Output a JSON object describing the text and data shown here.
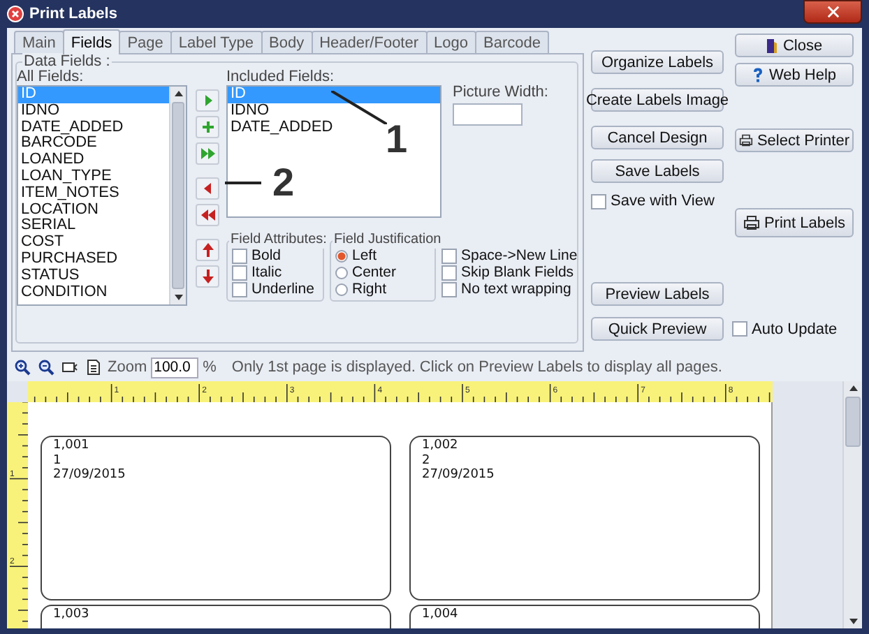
{
  "window": {
    "title": "Print Labels"
  },
  "tabs": [
    {
      "label": "Main",
      "selected": false
    },
    {
      "label": "Fields",
      "selected": true
    },
    {
      "label": "Page",
      "selected": false
    },
    {
      "label": "Label Type",
      "selected": false
    },
    {
      "label": "Body",
      "selected": false
    },
    {
      "label": "Header/Footer",
      "selected": false
    },
    {
      "label": "Logo",
      "selected": false
    },
    {
      "label": "Barcode",
      "selected": false
    }
  ],
  "data_fields": {
    "title": "Data Fields :",
    "all_fields_label": "All Fields:",
    "all_fields": [
      {
        "label": "ID",
        "selected": true
      },
      {
        "label": "IDNO",
        "selected": false
      },
      {
        "label": "DATE_ADDED",
        "selected": false
      },
      {
        "label": "BARCODE",
        "selected": false
      },
      {
        "label": "LOANED",
        "selected": false
      },
      {
        "label": "LOAN_TYPE",
        "selected": false
      },
      {
        "label": "ITEM_NOTES",
        "selected": false
      },
      {
        "label": "LOCATION",
        "selected": false
      },
      {
        "label": "SERIAL",
        "selected": false
      },
      {
        "label": "COST",
        "selected": false
      },
      {
        "label": "PURCHASED",
        "selected": false
      },
      {
        "label": "STATUS",
        "selected": false
      },
      {
        "label": "CONDITION",
        "selected": false
      }
    ],
    "included_fields_label": "Included Fields:",
    "included_fields": [
      {
        "label": "ID",
        "selected": true
      },
      {
        "label": "IDNO",
        "selected": false
      },
      {
        "label": "DATE_ADDED",
        "selected": false
      }
    ],
    "picture_width_label": "Picture Width:",
    "field_attributes": {
      "title": "Field Attributes:",
      "options": [
        {
          "label": "Bold",
          "checked": false
        },
        {
          "label": "Italic",
          "checked": false
        },
        {
          "label": "Underline",
          "checked": false
        }
      ]
    },
    "field_justification": {
      "title": "Field Justification",
      "options": [
        {
          "label": "Left",
          "selected": true
        },
        {
          "label": "Center",
          "selected": false
        },
        {
          "label": "Right",
          "selected": false
        }
      ]
    },
    "options": [
      {
        "label": "Space->New Line",
        "checked": false
      },
      {
        "label": "Skip Blank Fields",
        "checked": false
      },
      {
        "label": "No text wrapping",
        "checked": false
      }
    ]
  },
  "annotations": [
    {
      "text": "1"
    },
    {
      "text": "2"
    }
  ],
  "design_buttons": [
    "Organize Labels",
    "Create Labels Image",
    "Cancel Design",
    "Save Labels"
  ],
  "save_with_view": {
    "label": "Save with View",
    "checked": false
  },
  "preview_buttons": [
    "Preview Labels",
    "Quick Preview"
  ],
  "auto_update": {
    "label": "Auto Update",
    "checked": false
  },
  "side_buttons": [
    {
      "label": "Close",
      "kind": "close"
    },
    {
      "label": "Web Help",
      "kind": "help"
    },
    {
      "label": "Select Printer",
      "kind": "printer"
    },
    {
      "label": "Print Labels",
      "kind": "printer"
    }
  ],
  "toolbar": {
    "zoom_label": "Zoom",
    "zoom_value": "100.0",
    "zoom_unit": "%",
    "message": "Only 1st page is displayed. Click on Preview Labels to display all pages."
  },
  "ruler": {
    "horizontal": [
      "1",
      "2",
      "3",
      "4",
      "5",
      "6",
      "7",
      "8"
    ],
    "vertical": [
      "1",
      "2"
    ]
  },
  "labels": [
    {
      "lines": [
        "1,001",
        "1",
        "27/09/2015"
      ]
    },
    {
      "lines": [
        "1,002",
        "2",
        "27/09/2015"
      ]
    },
    {
      "lines": [
        "1,003"
      ]
    },
    {
      "lines": [
        "1,004"
      ]
    }
  ]
}
